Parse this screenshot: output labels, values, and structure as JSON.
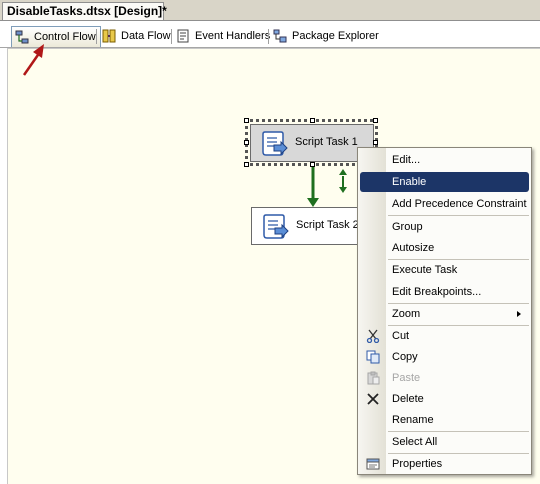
{
  "document": {
    "tab_title": "DisableTasks.dtsx [Design]*"
  },
  "designer_tabs": [
    {
      "label": "Control Flow",
      "icon": "control-flow-icon",
      "active": true
    },
    {
      "label": "Data Flow",
      "icon": "data-flow-icon",
      "active": false
    },
    {
      "label": "Event Handlers",
      "icon": "event-handlers-icon",
      "active": false
    },
    {
      "label": "Package Explorer",
      "icon": "package-explorer-icon",
      "active": false
    }
  ],
  "tasks": [
    {
      "label": "Script Task 1",
      "icon": "script-task-icon",
      "selected": true
    },
    {
      "label": "Script Task 2",
      "icon": "script-task-icon",
      "selected": false
    }
  ],
  "context_menu": {
    "items": [
      {
        "label": "Edit...",
        "icon": ""
      },
      {
        "label": "Enable",
        "icon": "",
        "highlighted": true
      },
      {
        "label": "Add Precedence Constraint",
        "icon": ""
      },
      {
        "label": "Group",
        "icon": ""
      },
      {
        "label": "Autosize",
        "icon": ""
      },
      {
        "label": "Execute Task",
        "icon": ""
      },
      {
        "label": "Edit Breakpoints...",
        "icon": ""
      },
      {
        "label": "Zoom",
        "icon": "submenu-arrow-icon"
      },
      {
        "label": "Cut",
        "icon": "scissors-icon"
      },
      {
        "label": "Copy",
        "icon": "copy-icon"
      },
      {
        "label": "Paste",
        "icon": "paste-icon",
        "disabled": true
      },
      {
        "label": "Delete",
        "icon": "delete-x-icon"
      },
      {
        "label": "Rename",
        "icon": ""
      },
      {
        "label": "Select All",
        "icon": ""
      },
      {
        "label": "Properties",
        "icon": "properties-icon"
      }
    ]
  },
  "colors": {
    "canvas_bg": "#fffeef",
    "menu_highlight": "#1c3567",
    "success_arrow": "#1f6f1f",
    "annotation_arrow": "#b01818"
  }
}
